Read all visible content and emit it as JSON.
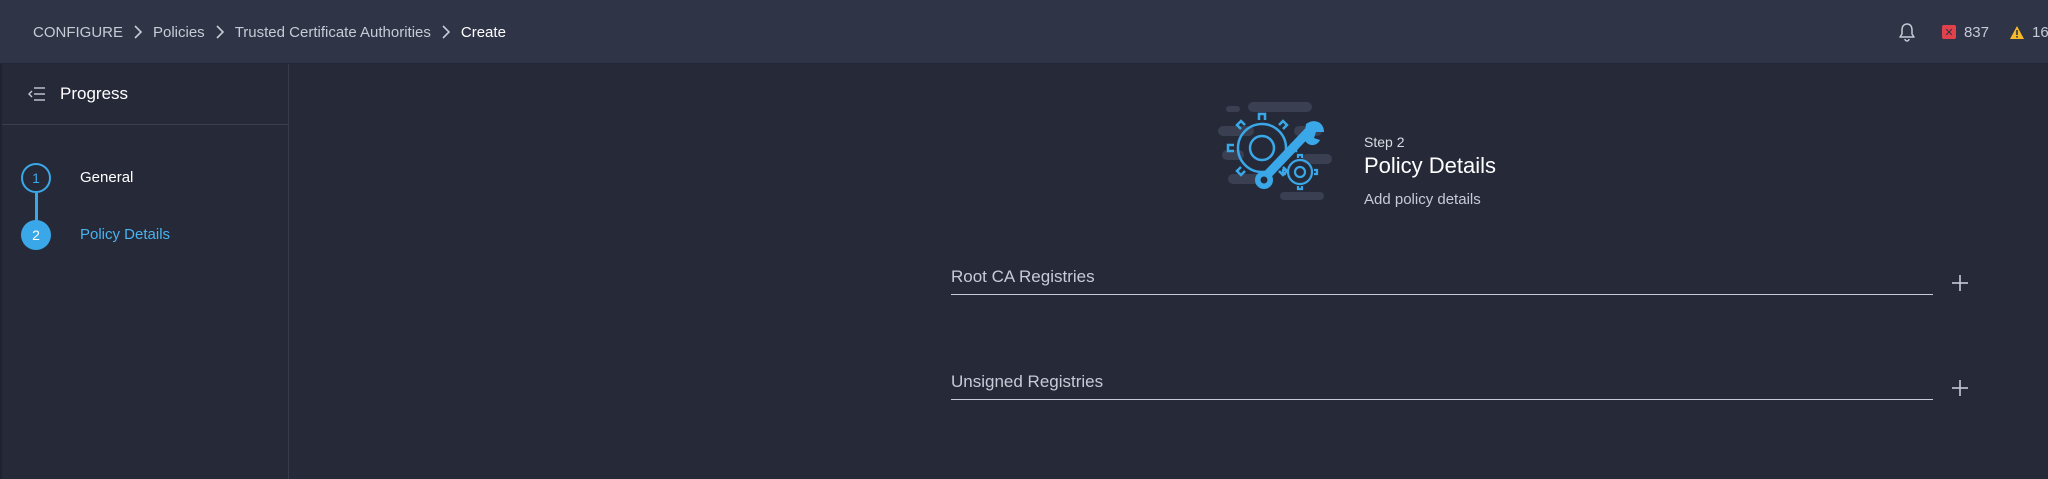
{
  "breadcrumb": {
    "items": [
      "CONFIGURE",
      "Policies",
      "Trusted Certificate Authorities"
    ],
    "current": "Create"
  },
  "status": {
    "errors": "837",
    "warnings": "16"
  },
  "sidebar": {
    "title": "Progress",
    "steps": [
      {
        "number": "1",
        "label": "General",
        "state": "completed"
      },
      {
        "number": "2",
        "label": "Policy Details",
        "state": "active"
      }
    ]
  },
  "step_header": {
    "step_num": "Step 2",
    "title": "Policy Details",
    "subtitle": "Add policy details"
  },
  "sections": [
    {
      "label": "Root CA Registries"
    },
    {
      "label": "Unsigned Registries"
    }
  ],
  "colors": {
    "accent": "#3aa8e8",
    "error": "#e2414c",
    "warning": "#f5b928",
    "background": "#262a38",
    "topbar": "#2f3446"
  },
  "icons": {
    "bell": "bell-icon",
    "error": "error-icon",
    "warning": "warning-icon",
    "collapse": "collapse-sidebar-icon",
    "add": "plus-icon",
    "illustration": "gears-wrench-illustration"
  }
}
